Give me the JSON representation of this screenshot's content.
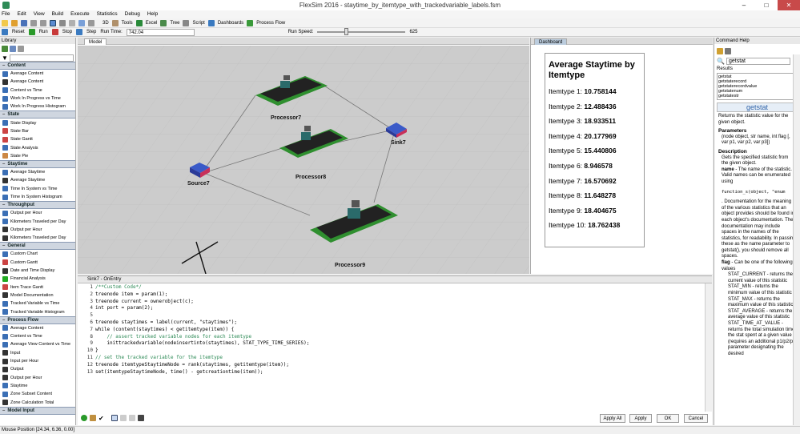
{
  "window": {
    "title": "FlexSim 2016 - staytime_by_itemtype_with_trackedvariable_labels.fsm"
  },
  "menu": [
    "File",
    "Edit",
    "View",
    "Build",
    "Execute",
    "Statistics",
    "Debug",
    "Help"
  ],
  "toolbar": {
    "btn_3d": "3D",
    "btn_tools": "Tools",
    "btn_excel": "Excel",
    "btn_tree": "Tree",
    "btn_script": "Script",
    "btn_dashboards": "Dashboards",
    "btn_processflow": "Process Flow"
  },
  "runbar": {
    "reset": "Reset",
    "run": "Run",
    "stop": "Stop",
    "step": "Step",
    "run_time_label": "Run Time:",
    "run_time": "742.04",
    "run_speed_label": "Run Speed:",
    "run_speed": "625"
  },
  "library": {
    "title": "Library",
    "groups": [
      {
        "name": "Content",
        "items": [
          [
            "Average Content",
            "#3b6fb5"
          ],
          [
            "Average Content",
            "#333333"
          ],
          [
            "Content vs Time",
            "#3b6fb5"
          ],
          [
            "Work In Progress vs Time",
            "#3b6fb5"
          ],
          [
            "Work In Progress Histogram",
            "#3b6fb5"
          ]
        ]
      },
      {
        "name": "State",
        "items": [
          [
            "State Display",
            "#3b6fb5"
          ],
          [
            "State Bar",
            "#c44"
          ],
          [
            "State Gantt",
            "#c44"
          ],
          [
            "State Analysis",
            "#3b6fb5"
          ],
          [
            "State Pie",
            "#c84"
          ]
        ]
      },
      {
        "name": "Staytime",
        "items": [
          [
            "Average Staytime",
            "#3b6fb5"
          ],
          [
            "Average Staytime",
            "#333333"
          ],
          [
            "Time In System vs Time",
            "#3b6fb5"
          ],
          [
            "Time In System Histogram",
            "#3b6fb5"
          ]
        ]
      },
      {
        "name": "Throughput",
        "items": [
          [
            "Output per Hour",
            "#3b6fb5"
          ],
          [
            "Kilometers Traveled per Day",
            "#3b6fb5"
          ],
          [
            "Output per Hour",
            "#333333"
          ],
          [
            "Kilometers Traveled per Day",
            "#333333"
          ]
        ]
      },
      {
        "name": "General",
        "items": [
          [
            "Custom Chart",
            "#3b6fb5"
          ],
          [
            "Custom Gantt",
            "#c44"
          ],
          [
            "Date and Time Display",
            "#333333"
          ],
          [
            "Financial Analysis",
            "#2a2"
          ],
          [
            "Item Trace Gantt",
            "#c44"
          ],
          [
            "Model Documentation",
            "#333333"
          ],
          [
            "Tracked Variable vs Time",
            "#3b6fb5"
          ],
          [
            "Tracked Variable Histogram",
            "#3b6fb5"
          ]
        ]
      },
      {
        "name": "Process Flow",
        "items": [
          [
            "Average Content",
            "#3b6fb5"
          ],
          [
            "Content vs Time",
            "#3b6fb5"
          ],
          [
            "Average View Content vs Time",
            "#3b6fb5"
          ],
          [
            "Input",
            "#333333"
          ],
          [
            "Input per Hour",
            "#333333"
          ],
          [
            "Output",
            "#333333"
          ],
          [
            "Output per Hour",
            "#333333"
          ],
          [
            "Staytime",
            "#3b6fb5"
          ],
          [
            "Zone Subset Content",
            "#3b6fb5"
          ],
          [
            "Zone Calculation Total",
            "#333333"
          ]
        ]
      },
      {
        "name": "Model Input",
        "items": []
      }
    ]
  },
  "model": {
    "tab": "Model",
    "objects": [
      "Processor7",
      "Sink7",
      "Processor8",
      "Source7",
      "Processor9"
    ]
  },
  "dashboard": {
    "tab": "Dashboard",
    "title": "Average Staytime by Itemtype",
    "rows": [
      {
        "label": "Itemtype 1: ",
        "value": "10.758144"
      },
      {
        "label": "Itemtype 2: ",
        "value": "12.488436"
      },
      {
        "label": "Itemtype 3: ",
        "value": "18.933511"
      },
      {
        "label": "Itemtype 4: ",
        "value": "20.177969"
      },
      {
        "label": "Itemtype 5: ",
        "value": "15.440806"
      },
      {
        "label": "Itemtype 6: ",
        "value": "8.946578"
      },
      {
        "label": "Itemtype 7: ",
        "value": "16.570692"
      },
      {
        "label": "Itemtype 8: ",
        "value": "11.648278"
      },
      {
        "label": "Itemtype 9: ",
        "value": "18.404675"
      },
      {
        "label": "Itemtype 10: ",
        "value": "18.762438"
      }
    ]
  },
  "command_help": {
    "title": "Command Help",
    "search": "getstat",
    "results_label": "Results",
    "results": [
      "getstat",
      "getstaterecord",
      "getstaterecordvalue",
      "getstatenum",
      "getstatestr"
    ],
    "name": "getstat",
    "summary": "Returns the statistic value for the given object.",
    "parameters_h": "Parameters",
    "parameters": "(node object, str name, int flag [, var p1, var p2, var p3])",
    "description_h": "Description",
    "description": "Gets the specified statistic from the given object.",
    "name_param": "name",
    "name_desc": " - The name of the statistic. Valid names can be enumerated using",
    "enum_call": "function_s(object, \"enum",
    "doc_more": ". Documentation for the meaning of the various statistics that an object provides should be found in each object's documentation. The documentation may include spaces in the names of the statistics, for readability. In passing these as the name parameter to getstat(), you should remove all spaces.",
    "flag_param": "flag",
    "flag_desc": " - Can be one of the following values",
    "flags": [
      "STAT_CURRENT - returns the current value of this statistic",
      "STAT_MIN - returns the minimum value of this statistic",
      "STAT_MAX - returns the maximum value of this statistic",
      "STAT_AVERAGE - returns the average value of this statistic",
      "STAT_TIME_AT_VALUE - returns the total simulation time the stat spent at a given value (requires an additional p1/p2/p3 parameter designating the desired"
    ]
  },
  "code": {
    "title": "Sink7 - OnEntry",
    "lines": [
      "/**Custom Code*/",
      "treenode item = param(1);",
      "treenode current = ownerobject(c);",
      "int port = param(2);",
      "",
      "treenode staytimes = label(current, \"staytimes\");",
      "while (content(staytimes) < getitemtype(item)) {",
      "    // assert tracked variable nodes for each itemtype",
      "    inittrackedvariable(nodeinsertinto(staytimes), STAT_TYPE_TIME_SERIES);",
      "}",
      "// set the tracked variable for the itemtype",
      "treenode itemtypeStaytimeNode = rank(staytimes, getitemtype(item));",
      "set(itemtypeStaytimeNode, time() - getcreationtime(item));"
    ],
    "buttons": {
      "apply_all": "Apply All",
      "apply": "Apply",
      "ok": "OK",
      "cancel": "Cancel"
    }
  },
  "status_bar": "Mouse Position [24.34, 6.36, 0.00]"
}
